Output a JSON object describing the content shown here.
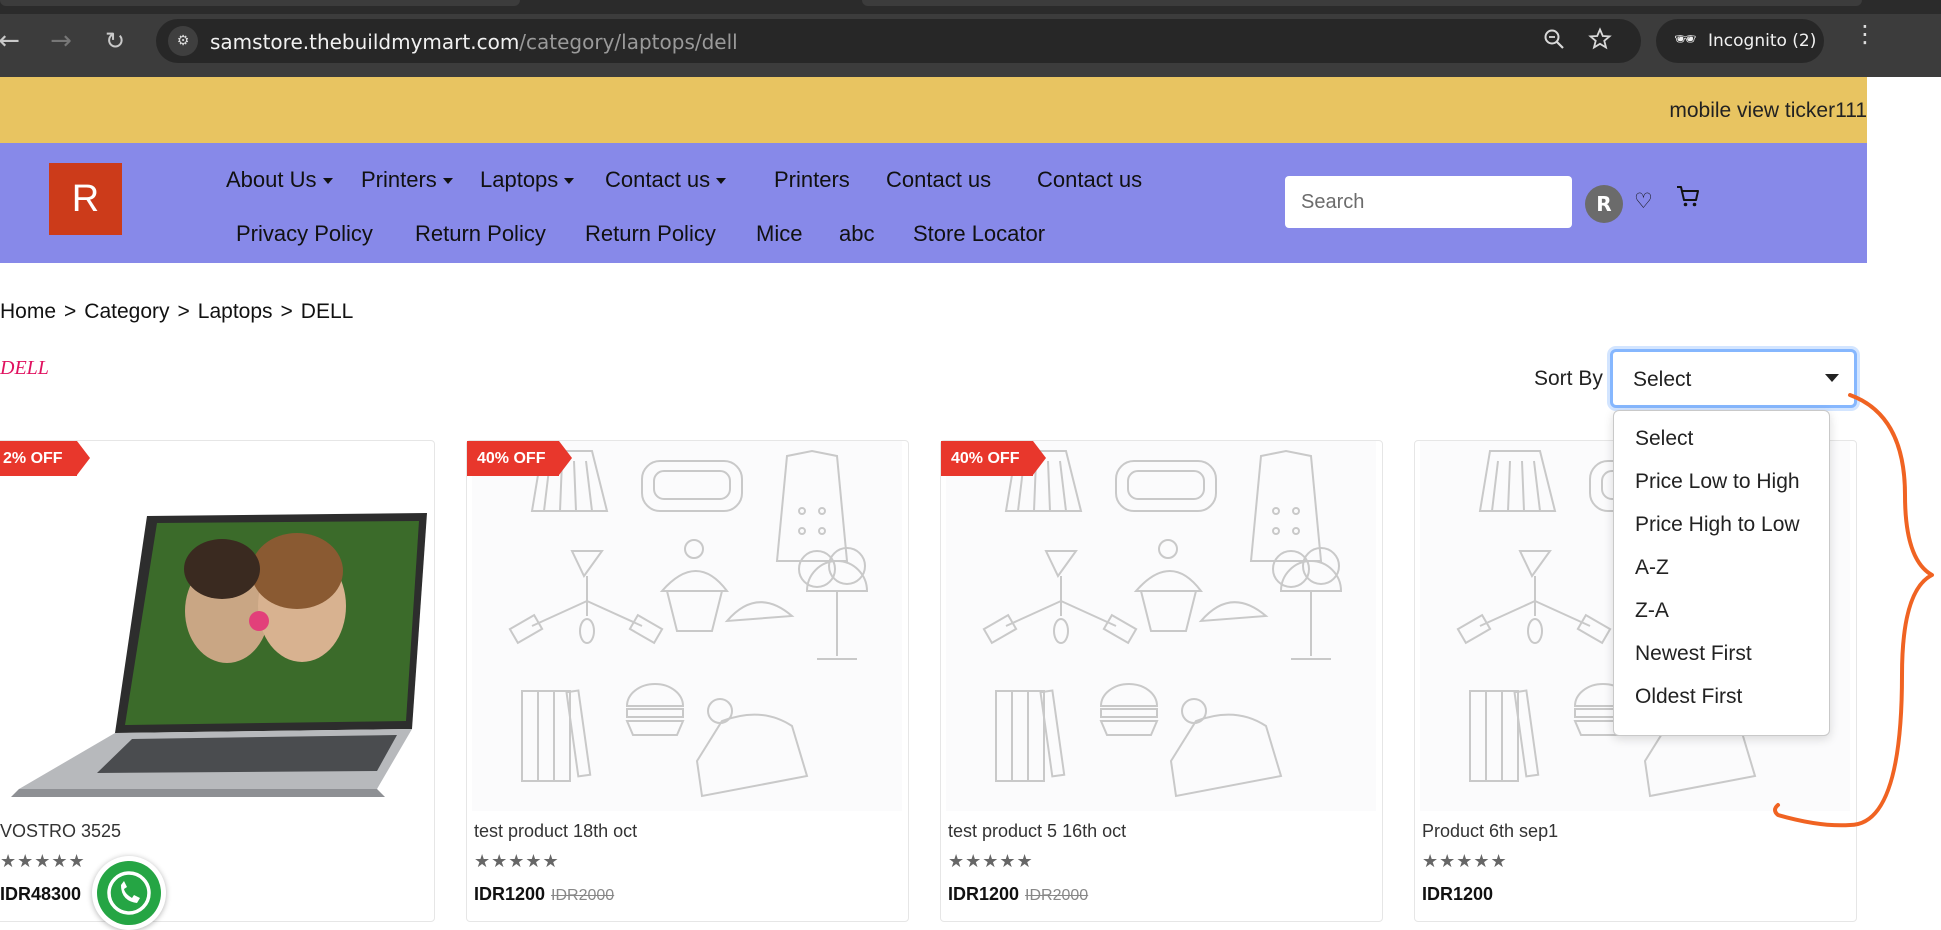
{
  "browser": {
    "url_host": "samstore.thebuildmymart.com",
    "url_path": "/category/laptops/dell",
    "incognito_label": "Incognito (2)"
  },
  "ticker": {
    "text": "mobile view ticker111"
  },
  "header": {
    "logo_letter": "R",
    "nav_row1": [
      {
        "label": "About Us",
        "dropdown": true
      },
      {
        "label": "Printers",
        "dropdown": true
      },
      {
        "label": "Laptops",
        "dropdown": true
      },
      {
        "label": "Contact us",
        "dropdown": true
      },
      {
        "label": "Printers",
        "dropdown": false
      },
      {
        "label": "Contact us",
        "dropdown": false
      },
      {
        "label": "Contact us",
        "dropdown": false
      }
    ],
    "nav_row2": [
      {
        "label": "Privacy Policy"
      },
      {
        "label": "Return Policy"
      },
      {
        "label": "Return Policy"
      },
      {
        "label": "Mice"
      },
      {
        "label": "abc"
      },
      {
        "label": "Store Locator"
      }
    ],
    "search_placeholder": "Search",
    "avatar_letter": "R"
  },
  "breadcrumb": [
    "Home",
    "Category",
    "Laptops",
    "DELL"
  ],
  "category_title": "DELL",
  "sort": {
    "label": "Sort By",
    "selected": "Select",
    "options": [
      "Select",
      "Price Low to High",
      "Price High to Low",
      "A-Z",
      "Z-A",
      "Newest First",
      "Oldest First"
    ]
  },
  "products": [
    {
      "badge": "2% OFF",
      "name": "VOSTRO 3525",
      "rating": "★★★★★",
      "price": "IDR48300",
      "old_price": "",
      "image": "laptop"
    },
    {
      "badge": "40% OFF",
      "name": "test product 18th oct",
      "rating": "★★★★★",
      "price": "IDR1200",
      "old_price": "IDR2000",
      "image": "placeholder"
    },
    {
      "badge": "40% OFF",
      "name": "test product 5 16th oct",
      "rating": "★★★★★",
      "price": "IDR1200",
      "old_price": "IDR2000",
      "image": "placeholder"
    },
    {
      "badge": "",
      "name": "Product 6th sep1",
      "rating": "★★★★★",
      "price": "IDR1200",
      "old_price": "",
      "image": "placeholder"
    }
  ],
  "colors": {
    "ticker_bg": "#e8c461",
    "header_bg": "#8789e9",
    "logo_bg": "#cc3b1a",
    "badge_bg": "#e8372c",
    "category_title": "#e0115f",
    "select_focus": "#86b7fe",
    "annotation": "#f06322",
    "whatsapp": "#25a544"
  },
  "icons": [
    "back-arrow-icon",
    "forward-arrow-icon",
    "reload-icon",
    "site-info-icon",
    "zoom-icon",
    "star-icon",
    "incognito-icon",
    "kebab-menu-icon",
    "heart-icon",
    "cart-icon",
    "whatsapp-icon"
  ]
}
